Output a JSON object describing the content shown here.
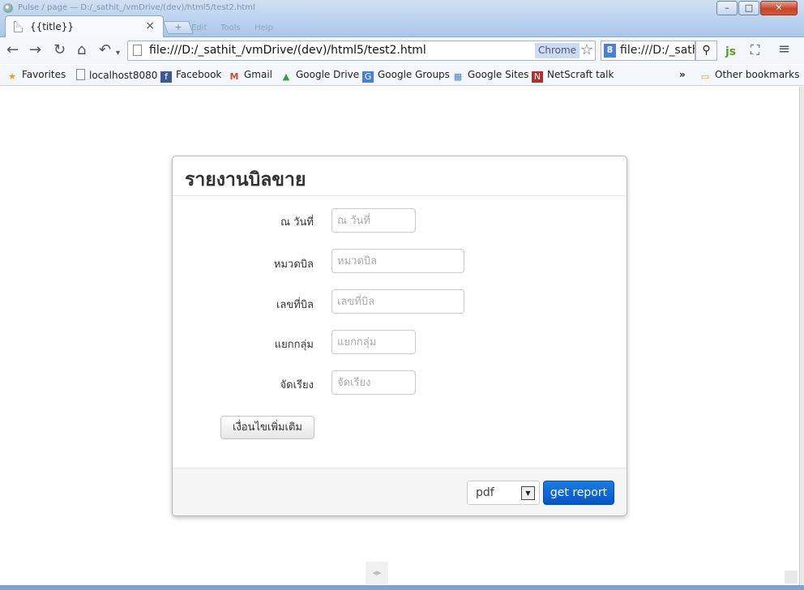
{
  "window": {
    "title": "Pulse / page — D:/_sathit_/vmDrive/(dev)/html5/test2.html"
  },
  "tab": {
    "label": "{{title}}",
    "close": "×"
  },
  "ghost_menu": [
    "Edit",
    "Tools",
    "Help"
  ],
  "toolbar": {
    "back_icon": "←",
    "forward_icon": "→",
    "reload_icon": "↻",
    "home_icon": "⌂",
    "undo_icon": "↶",
    "url": "file:///D:/_sathit_/vmDrive/(dev)/html5/test2.html",
    "badge": "Chrome",
    "search_query": "file:///D:/_sathit_/vm",
    "search_engine": "8"
  },
  "bookmarks": {
    "items": [
      {
        "label": "Favorites",
        "color": "#e8a010",
        "glyph": "★"
      },
      {
        "label": "localhost8080",
        "color": "#ffffff",
        "glyph": ""
      },
      {
        "label": "Facebook",
        "color": "#3b5998",
        "glyph": "f"
      },
      {
        "label": "Gmail",
        "color": "#d14836",
        "glyph": "M"
      },
      {
        "label": "Google Drive",
        "color": "#2f9e44",
        "glyph": "▲"
      },
      {
        "label": "Google Groups",
        "color": "#4a7fd8",
        "glyph": "G"
      },
      {
        "label": "Google Sites",
        "color": "#4a7fd8",
        "glyph": "▦"
      },
      {
        "label": "NetScraft talk",
        "color": "#b03030",
        "glyph": "N"
      }
    ],
    "overflow": "»",
    "other": "Other bookmarks"
  },
  "form": {
    "title": "รายงานบิลขาย",
    "fields": [
      {
        "label": "ณ วันที่",
        "placeholder": "ณ วันที่"
      },
      {
        "label": "หมวดบิล",
        "placeholder": "หมวดบิล"
      },
      {
        "label": "เลขที่บิล",
        "placeholder": "เลขที่บิล"
      },
      {
        "label": "แยกกลุ่ม",
        "placeholder": "แยกกลุ่ม"
      },
      {
        "label": "จัดเรียง",
        "placeholder": "จัดเรียง"
      }
    ],
    "more_button": "เงื่อนไขเพิ่มเติม",
    "format": {
      "value": "pdf"
    },
    "submit_button": "get report"
  }
}
